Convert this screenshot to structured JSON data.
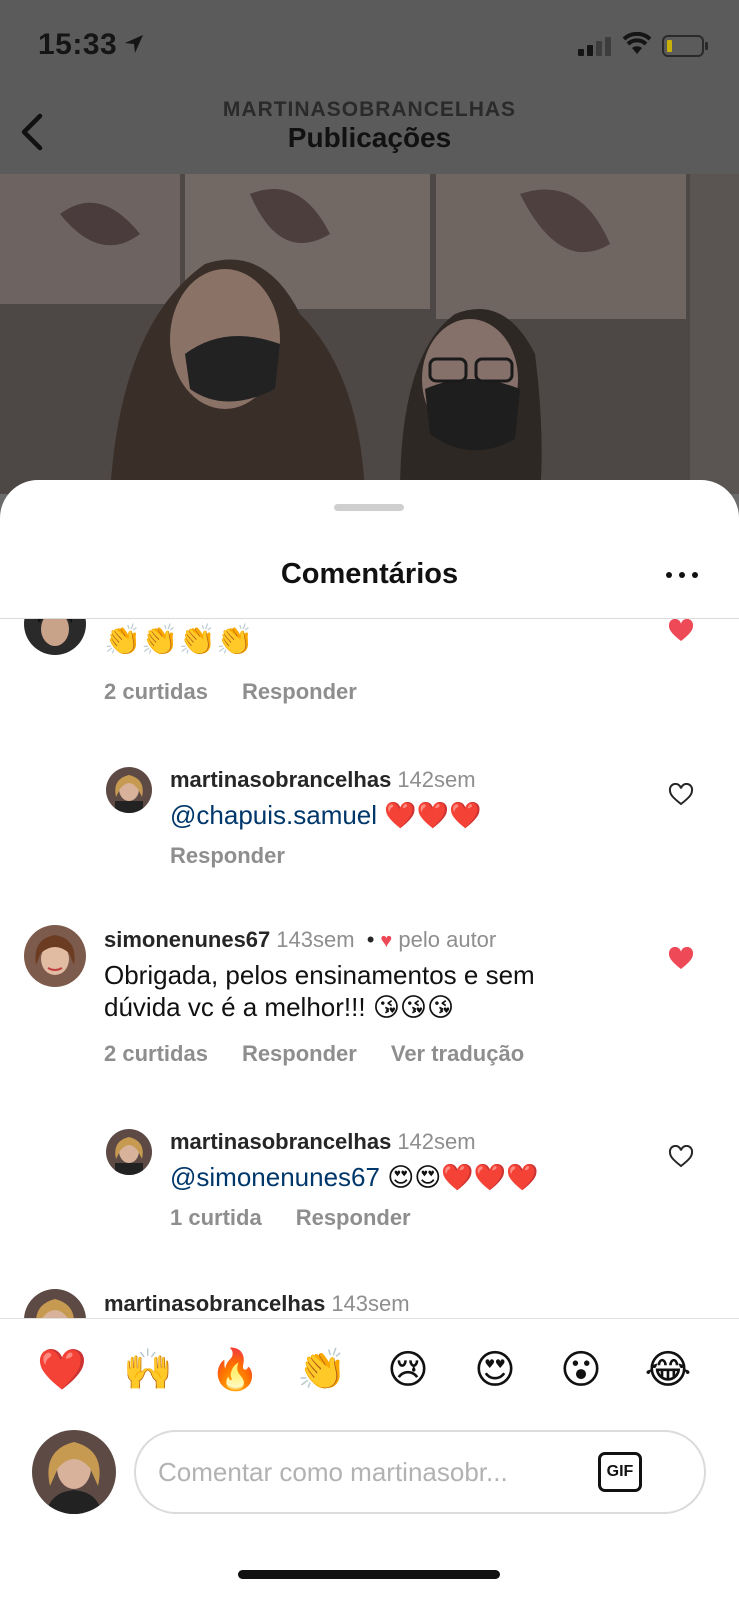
{
  "status_bar": {
    "time": "15:33"
  },
  "header": {
    "username": "MARTINASOBRANCELHAS",
    "title": "Publicações"
  },
  "sheet": {
    "title": "Comentários"
  },
  "comments": [
    {
      "emoji_text": "👏👏👏👏",
      "actions": {
        "likes": "2 curtidas",
        "reply": "Responder"
      },
      "liked": true
    },
    {
      "username": "martinasobrancelhas",
      "time": "142sem",
      "mention": "@chapuis.samuel",
      "emoji": "❤️❤️❤️",
      "actions": {
        "reply": "Responder"
      },
      "liked": false
    },
    {
      "username": "simonenunes67",
      "time": "143sem",
      "separator": "•",
      "author_badge": "pelo autor",
      "text_line1": "Obrigada,  pelos ensinamentos e sem",
      "text_line2": "dúvida vc é a melhor!!!",
      "emoji": "😘😘😘",
      "actions": {
        "likes": "2 curtidas",
        "reply": "Responder",
        "translate": "Ver tradução"
      },
      "liked": true
    },
    {
      "username": "martinasobrancelhas",
      "time": "142sem",
      "mention": "@simonenunes67",
      "emoji": "😍😍❤️❤️❤️",
      "actions": {
        "likes": "1 curtida",
        "reply": "Responder"
      },
      "liked": false
    },
    {
      "username": "martinasobrancelhas",
      "time": "143sem"
    }
  ],
  "quick_emojis": [
    "❤️",
    "🙌",
    "🔥",
    "👏",
    "😢",
    "😍",
    "😮",
    "😂"
  ],
  "composer": {
    "placeholder": "Comentar como martinasobr...",
    "gif_label": "GIF"
  },
  "colors": {
    "like_red": "#ed4956",
    "mention_blue": "#00376b",
    "muted": "#8e8e8e"
  }
}
